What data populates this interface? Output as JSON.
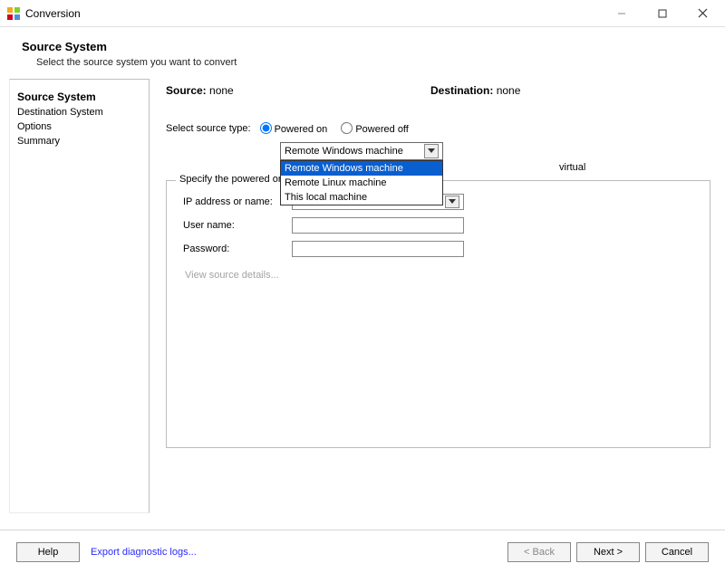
{
  "window": {
    "title": "Conversion"
  },
  "header": {
    "heading": "Source System",
    "subheading": "Select the source system you want to convert"
  },
  "sidebar": {
    "items": [
      {
        "label": "Source System",
        "active": true
      },
      {
        "label": "Destination System",
        "active": false
      },
      {
        "label": "Options",
        "active": false
      },
      {
        "label": "Summary",
        "active": false
      }
    ]
  },
  "info": {
    "source_label": "Source:",
    "source_value": "none",
    "dest_label": "Destination:",
    "dest_value": "none"
  },
  "source_type": {
    "label": "Select source type:",
    "options": {
      "powered_on": "Powered on",
      "powered_off": "Powered off"
    },
    "selected": "powered_on"
  },
  "machine_combo": {
    "selected": "Remote Windows machine",
    "options": [
      "Remote Windows machine",
      "Remote Linux machine",
      "This local machine"
    ],
    "behind_text": "virtual"
  },
  "fieldset": {
    "legend": "Specify the powered on machine",
    "ip_label": "IP address or name:",
    "ip_value": "",
    "user_label": "User name:",
    "user_value": "",
    "pw_label": "Password:",
    "pw_value": "",
    "details_link": "View source details..."
  },
  "footer": {
    "help": "Help",
    "export": "Export diagnostic logs...",
    "back": "< Back",
    "next": "Next >",
    "cancel": "Cancel"
  }
}
